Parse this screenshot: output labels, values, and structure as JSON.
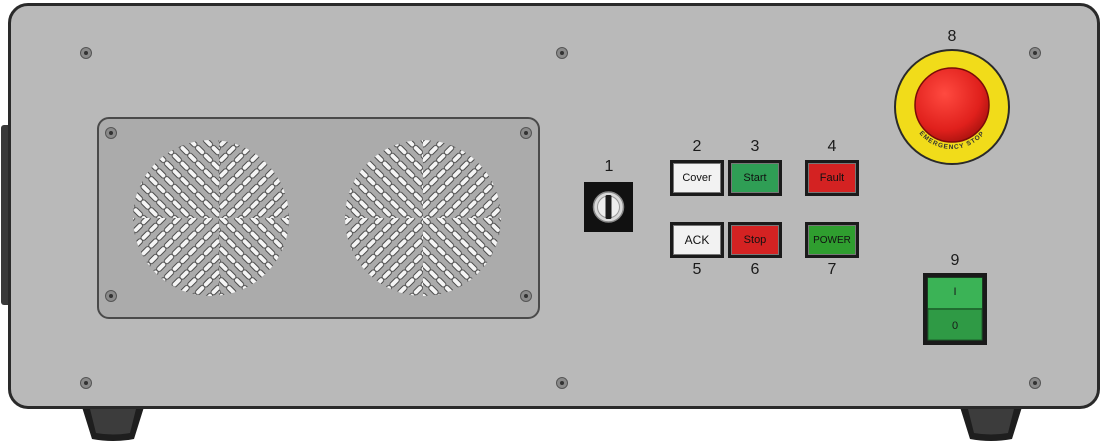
{
  "controls": {
    "key_switch_number": "1",
    "cover": {
      "number": "2",
      "label": "Cover",
      "color": "#f2f2f2"
    },
    "start": {
      "number": "3",
      "label": "Start",
      "color": "#2f9e55"
    },
    "fault": {
      "number": "4",
      "label": "Fault",
      "color": "#d42222"
    },
    "ack": {
      "number": "5",
      "label": "ACK",
      "color": "#f2f2f2"
    },
    "stop": {
      "number": "6",
      "label": "Stop",
      "color": "#d42222"
    },
    "power": {
      "number": "7",
      "label": "POWER",
      "color": "#2f9e2f"
    },
    "emergency_stop": {
      "number": "8",
      "ring_text": "EMERGENCY STOP",
      "button_color": "#e0201c",
      "ring_color": "#f1dc1a"
    },
    "main_switch": {
      "number": "9",
      "on_label": "I",
      "off_label": "0",
      "color": "#2f9a45"
    }
  }
}
